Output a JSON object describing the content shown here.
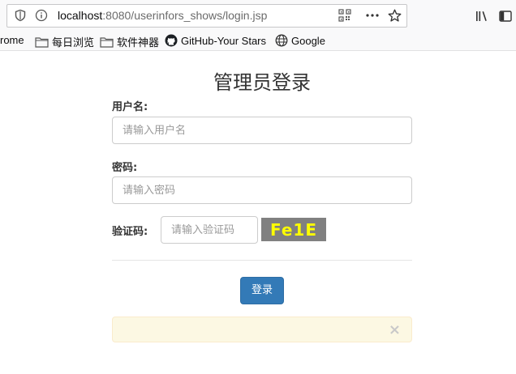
{
  "browser": {
    "url_host": "localhost",
    "url_path": ":8080/userinfors_shows/login.jsp"
  },
  "bookmarks": [
    {
      "label": "rome"
    },
    {
      "label": "每日浏览"
    },
    {
      "label": "软件神器"
    },
    {
      "label": "GitHub-Your Stars"
    },
    {
      "label": "Google"
    }
  ],
  "form": {
    "title": "管理员登录",
    "username_label": "用户名:",
    "username_placeholder": "请输入用户名",
    "password_label": "密码:",
    "password_placeholder": "请输入密码",
    "captcha_label": "验证码:",
    "captcha_placeholder": "请输入验证码",
    "captcha_code": "Fe1E",
    "submit_label": "登录"
  },
  "alert": {
    "close_symbol": "×"
  },
  "colors": {
    "primary": "#337ab7",
    "captcha_bg": "#808080",
    "captcha_text": "#ffff00",
    "alert_bg": "#fcf8e3"
  }
}
